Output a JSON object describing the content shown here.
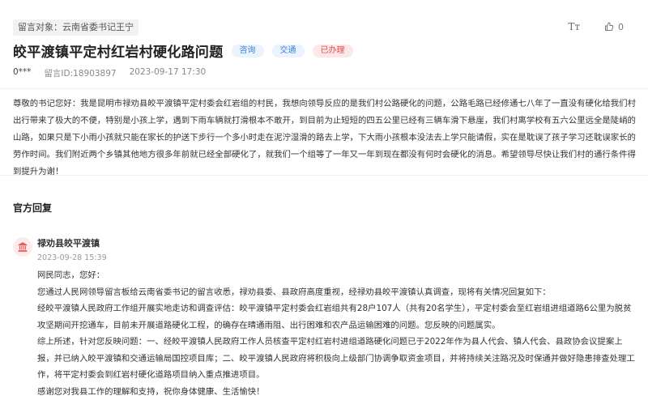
{
  "recipient_label": "留言对象：云南省委书记王宁",
  "tools": {
    "font_icon_text": "Tт",
    "like_count": "0"
  },
  "title": "皎平渡镇平定村红岩村硬化路问题",
  "tags": [
    "咨询",
    "交通",
    "已办理"
  ],
  "meta": {
    "author": "0***",
    "message_id": "留言ID:18903897",
    "time": "2023-09-17 17:30"
  },
  "message": "尊敬的书记您好：我是昆明市禄劝县皎平渡镇平定村委会红岩组的村民，我想向领导反应的是我们村公路硬化的问题，公路毛路已经修通七八年了一直没有硬化给我们村出行带来了极大的不便，特别是小孩上学，遇到下雨车辆就打滑根本不敢开，到目前为止短短的四五公里已经有三辆车滑下悬崖，我们村离学校有五六公里远全是陡峭的山路，如果只是下小雨小孩就只能在家长的护送下步行一个多小时走在泥泞湿滑的路去上学，下大雨小孩根本没法去上学只能请假，实在是耽误了孩子学习还耽误家长的劳作时间。我们附近两个乡镇其他地方很多年前就已经全部硬化了，就我们一个组等了一年又一年到现在都没有何时会硬化的消息。希望领导尽快让我们村的通行条件得到提升为谢！",
  "reply_section_title": "官方回复",
  "reply": {
    "org": "禄劝县皎平渡镇",
    "time": "2023-09-28 15:39",
    "paragraphs": [
      "网民同志，您好：",
      "您通过人民网领导留言板给云南省委书记的留言收悉，禄劝县委、县政府高度重视，经禄劝县皎平渡镇认真调查，现将有关情况回复如下：",
      "经皎平渡镇人民政府工作组开展实地走访和调查评估：皎平渡镇平定村委会红岩组共有28户107人（共有20名学生），平定村委会至红岩组进组道路6公里为脱贫攻坚期间开挖通车，目前未开展道路硬化工程，的确存在晴通雨阻、出行困难和农产品运输困难的问题。您反映的问题属实。",
      "综上所述，针对您反映问题：一、经皎平渡镇人民政府工作人员核查平定村红岩村进组道路硬化问题已于2022年作为县人代会、镇人代会、县政协会议提案上报，并已纳入皎平渡镇和交通运输局国控项目库；二、皎平渡镇人民政府将积极向上级部门协调争取资金项目，并将持续关注路况及时保通并做好隐患排查处理工作，将平定村委会到红岩村硬化道路项目纳入重点推进项目。",
      "感谢您对我县工作的理解和支持，祝你身体健康、生活愉快！"
    ]
  },
  "colors": {
    "tag_blue": "#3d7fd9",
    "tag_red": "#e34b4b",
    "avatar_red": "#e85b5b"
  }
}
